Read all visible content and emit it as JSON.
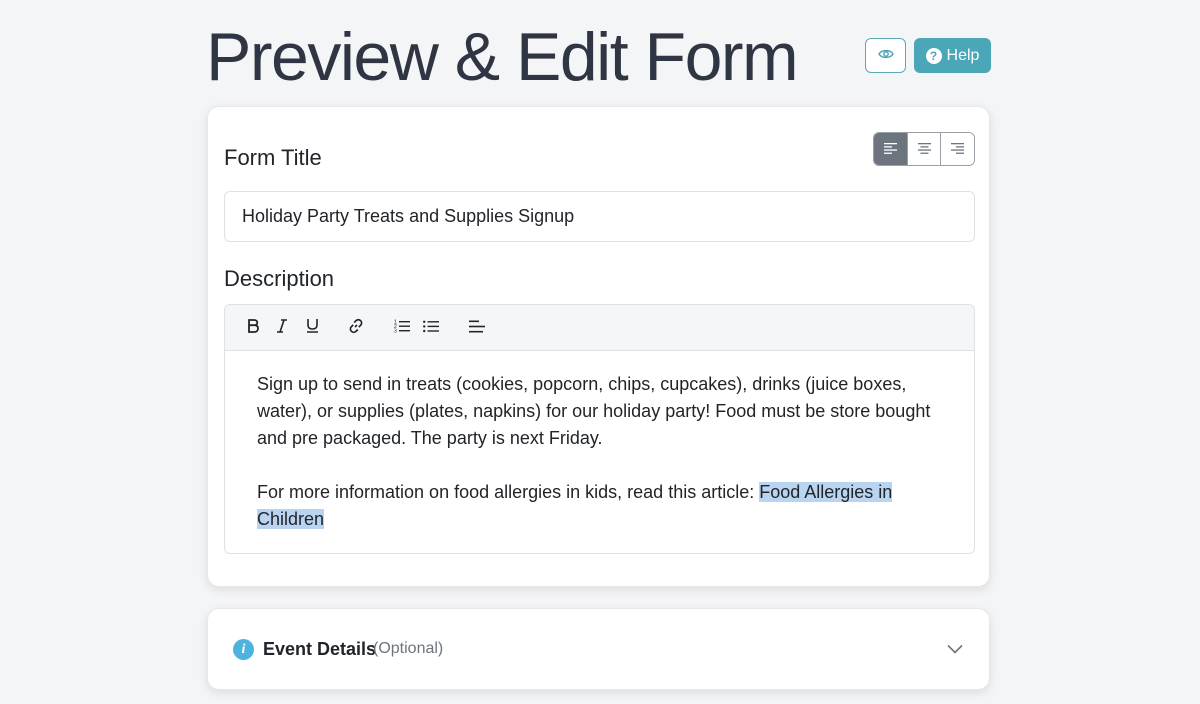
{
  "page": {
    "title": "Preview & Edit Form",
    "help_label": "Help"
  },
  "icons": {
    "preview": "eye-icon",
    "help": "question-circle-icon",
    "align": [
      "align-left-icon",
      "align-center-icon",
      "align-right-icon"
    ],
    "toolbar": [
      "bold-icon",
      "italic-icon",
      "underline-icon",
      "link-icon",
      "ordered-list-icon",
      "unordered-list-icon",
      "align-left-icon"
    ],
    "event_info": "info-icon",
    "expand": "chevron-down-icon"
  },
  "form": {
    "title_label": "Form Title",
    "title_value": "Holiday Party Treats and Supplies Signup",
    "title_alignment_selected": "left",
    "description_label": "Description",
    "description_paragraph_1": "Sign up to send in treats (cookies, popcorn, chips, cupcakes), drinks (juice boxes, water), or supplies (plates, napkins) for our holiday party! Food must be store bought and pre packaged. The party is next Friday.",
    "description_paragraph_2_prefix": "For more information on food allergies in kids, read this article: ",
    "description_link_text": "Food Allergies in Children"
  },
  "event_details": {
    "title": "Event Details",
    "optional_label": "(Optional)"
  },
  "colors": {
    "accent": "#4ba6b8",
    "selection": "#b9d4f1",
    "active_align": "#6c757d",
    "info": "#4cb3df"
  }
}
